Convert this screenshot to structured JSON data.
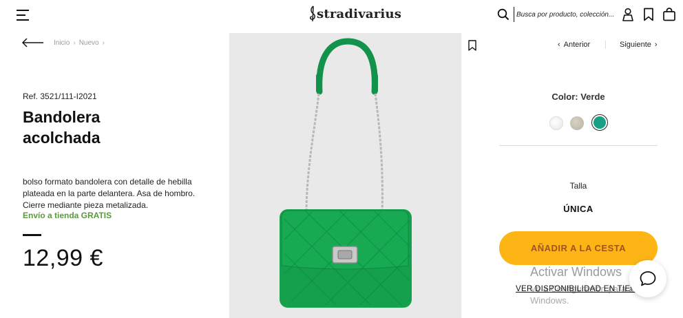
{
  "header": {
    "logo_text": "stradivarius",
    "search_placeholder": "Busca por producto, colección..."
  },
  "breadcrumb": [
    "Inicio",
    "Nuevo"
  ],
  "product": {
    "ref": "Ref. 3521/111-I2021",
    "title": "Bandolera acolchada",
    "description": "bolso formato bandolera con detalle de hebilla plateada en la parte delantera. Asa de hombro. Cierre mediante pieza metalizada.",
    "shipping": "Envío a tienda GRATIS",
    "price": "12,99 €"
  },
  "nav": {
    "previous": "Anterior",
    "next": "Siguiente"
  },
  "color": {
    "label": "Color: Verde",
    "swatches": [
      {
        "name": "white",
        "hex": "#f2f2f2"
      },
      {
        "name": "beige",
        "hex": "#c9c2b3"
      },
      {
        "name": "green",
        "hex": "#16a085",
        "selected": true
      }
    ]
  },
  "size": {
    "label": "Talla",
    "value": "ÚNICA"
  },
  "actions": {
    "add_to_cart": "AÑADIR A LA CESTA",
    "availability": "VER DISPONIBILIDAD EN TIENDA"
  },
  "overlay": {
    "watermark_title": "Activar Windows",
    "watermark_sub": "Ve a Configuración para activar Windows."
  },
  "colors": {
    "accent_button": "#fdb515",
    "shipping_green": "#5a9a3b",
    "bag_green": "#14a04c"
  }
}
